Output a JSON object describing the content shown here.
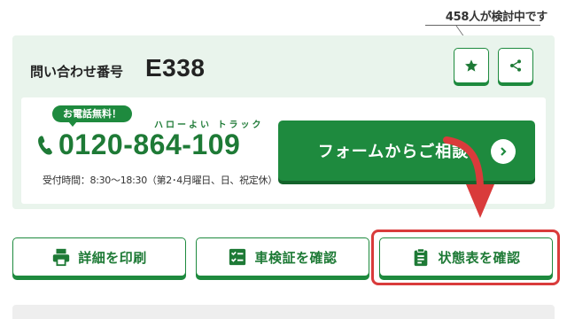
{
  "header": {
    "viewer_count": "458人が検討中です"
  },
  "inquiry": {
    "label": "問い合わせ番号",
    "number": "E338"
  },
  "icons": {
    "favorite": "star-icon",
    "share": "share-icon"
  },
  "phone": {
    "badge": "お電話無料！",
    "ruby": "ハローよい トラック",
    "number": "0120-864-109",
    "hours": "受付時間：8:30〜18:30（第2･4月曜日、日、祝定休）"
  },
  "form_button": {
    "label": "フォームからご相談"
  },
  "actions": [
    {
      "label": "詳細を印刷",
      "icon": "printer-icon"
    },
    {
      "label": "車検証を確認",
      "icon": "checklist-icon"
    },
    {
      "label": "状態表を確認",
      "icon": "clipboard-icon"
    }
  ],
  "colors": {
    "brand_green": "#1e8a3e",
    "light_green_bg": "#e9f4ec",
    "highlight_red": "#d93b3b"
  }
}
